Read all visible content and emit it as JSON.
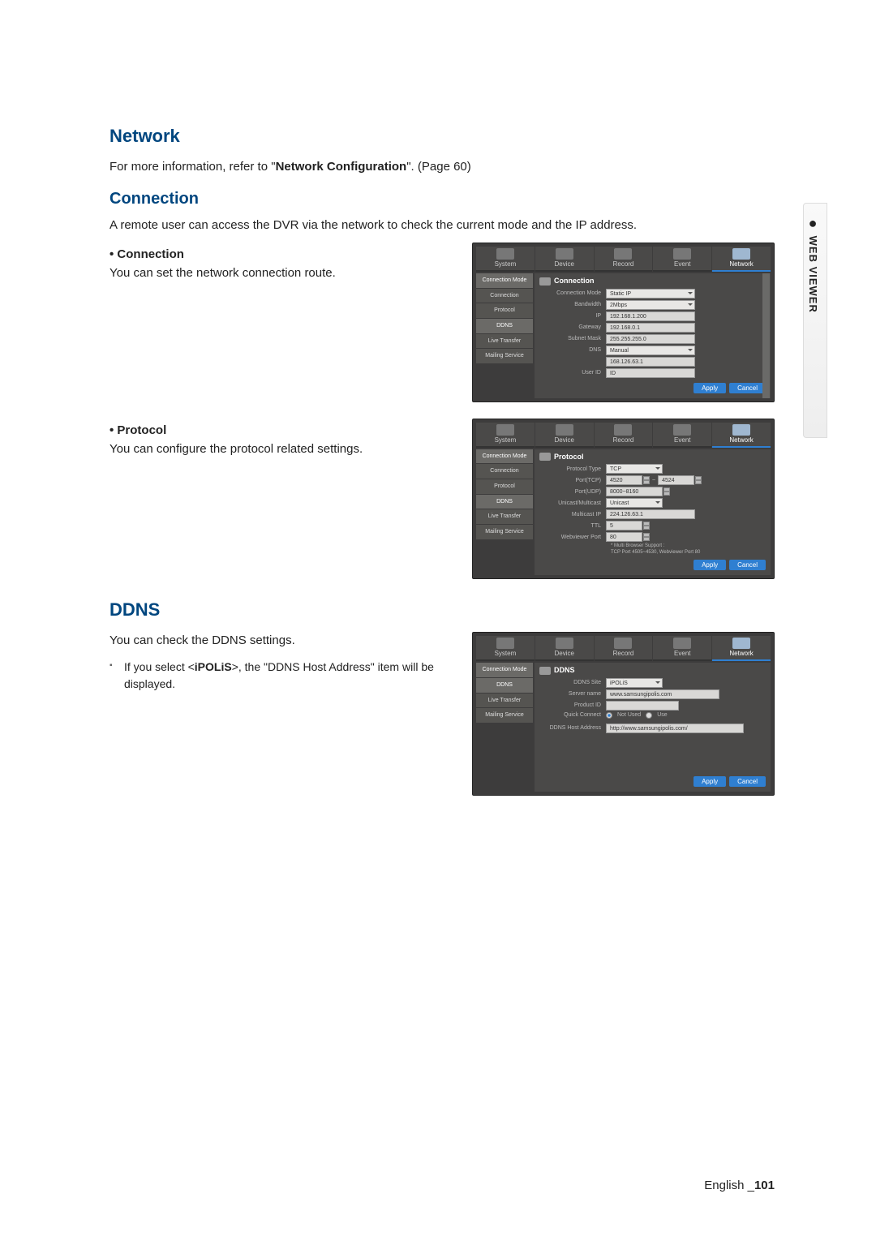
{
  "side_tab": "WEB VIEWER",
  "headings": {
    "network": "Network",
    "connection": "Connection",
    "ddns": "DDNS"
  },
  "network": {
    "intro_pre": "For more information, refer to \"",
    "intro_bold": "Network Configuration",
    "intro_post": "\". (Page 60)"
  },
  "connection": {
    "desc": "A remote user can access the DVR via the network to check the current mode and the IP address.",
    "bullet": "Connection",
    "sub": "You can set the network connection route."
  },
  "protocol": {
    "bullet": "Protocol",
    "sub": "You can configure the protocol related settings."
  },
  "ddns": {
    "desc": "You can check the DDNS settings.",
    "note_pre": "If you select <",
    "note_bold": "iPOLiS",
    "note_post": ">, the \"DDNS Host Address\" item will be displayed."
  },
  "tabs": [
    "System",
    "Device",
    "Record",
    "Event",
    "Network"
  ],
  "side1": [
    "Connection Mode",
    "Connection",
    "Protocol",
    "DDNS",
    "Live Transfer",
    "Mailing Service"
  ],
  "side2": [
    "Connection Mode",
    "DDNS",
    "Live Transfer",
    "Mailing Service"
  ],
  "panel_conn": {
    "title": "Connection",
    "f": [
      {
        "l": "Connection Mode",
        "v": "Static IP"
      },
      {
        "l": "Bandwidth",
        "v": "2Mbps"
      },
      {
        "l": "IP",
        "v": "192.168.1.200"
      },
      {
        "l": "Gateway",
        "v": "192.168.0.1"
      },
      {
        "l": "Subnet Mask",
        "v": "255.255.255.0"
      },
      {
        "l": "DNS",
        "v": "Manual"
      },
      {
        "l": "",
        "v": "168.126.63.1"
      },
      {
        "l": "User ID",
        "v": "ID"
      }
    ]
  },
  "panel_proto": {
    "title": "Protocol",
    "f": [
      {
        "l": "Protocol Type",
        "v": "TCP"
      },
      {
        "l": "Port(TCP)",
        "v": "4520",
        "v2": "4524"
      },
      {
        "l": "Port(UDP)",
        "v": "8000~8160"
      },
      {
        "l": "Unicast/Multicast",
        "v": "Unicast"
      },
      {
        "l": "Multicast IP",
        "v": "224.126.63.1"
      },
      {
        "l": "TTL",
        "v": "5"
      },
      {
        "l": "Webviewer Port",
        "v": "80"
      }
    ],
    "note1": "* Multi Browser Support :",
    "note2": "TCP Port 4505~4530, Webviewer Port 80"
  },
  "panel_ddns": {
    "title": "DDNS",
    "f": [
      {
        "l": "DDNS Site",
        "v": "iPOLiS"
      },
      {
        "l": "Server name",
        "v": "www.samsungipolis.com"
      },
      {
        "l": "Product ID",
        "v": ""
      },
      {
        "l": "Quick Connect",
        "v": "Not Used",
        "v2": "Use"
      },
      {
        "l": "DDNS Host Address",
        "v": "http://www.samsungipolis.com/"
      }
    ]
  },
  "buttons": {
    "apply": "Apply",
    "cancel": "Cancel"
  },
  "footer": {
    "lang": "English",
    "page": "101"
  }
}
